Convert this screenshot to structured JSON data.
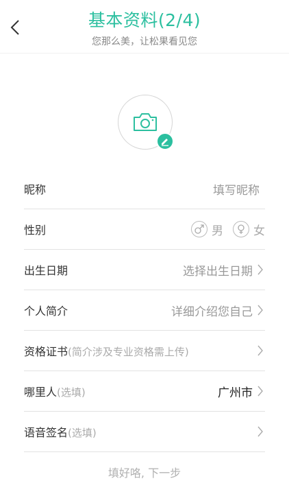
{
  "header": {
    "title": "基本资料(2/4)",
    "subtitle": "您那么美，让松果看见您",
    "back_icon": "chevron-left-icon"
  },
  "avatar": {
    "icon": "camera-icon",
    "edit_icon": "pencil-icon"
  },
  "form": {
    "nickname": {
      "label": "昵称",
      "placeholder": "填写昵称"
    },
    "gender": {
      "label": "性别",
      "male": "男",
      "female": "女"
    },
    "birthday": {
      "label": "出生日期",
      "placeholder": "选择出生日期"
    },
    "intro": {
      "label": "个人简介",
      "placeholder": "详细介绍您自己"
    },
    "certificate": {
      "label": "资格证书",
      "hint": "(简介涉及专业资格需上传)"
    },
    "hometown": {
      "label": "哪里人",
      "hint": "(选填)",
      "value": "广州市"
    },
    "voice": {
      "label": "语音签名",
      "hint": "(选填)"
    }
  },
  "next_button": "填好咯, 下一步",
  "colors": {
    "accent": "#2bbf9f",
    "text": "#333333",
    "placeholder": "#999999",
    "divider": "#e2e2e2"
  }
}
